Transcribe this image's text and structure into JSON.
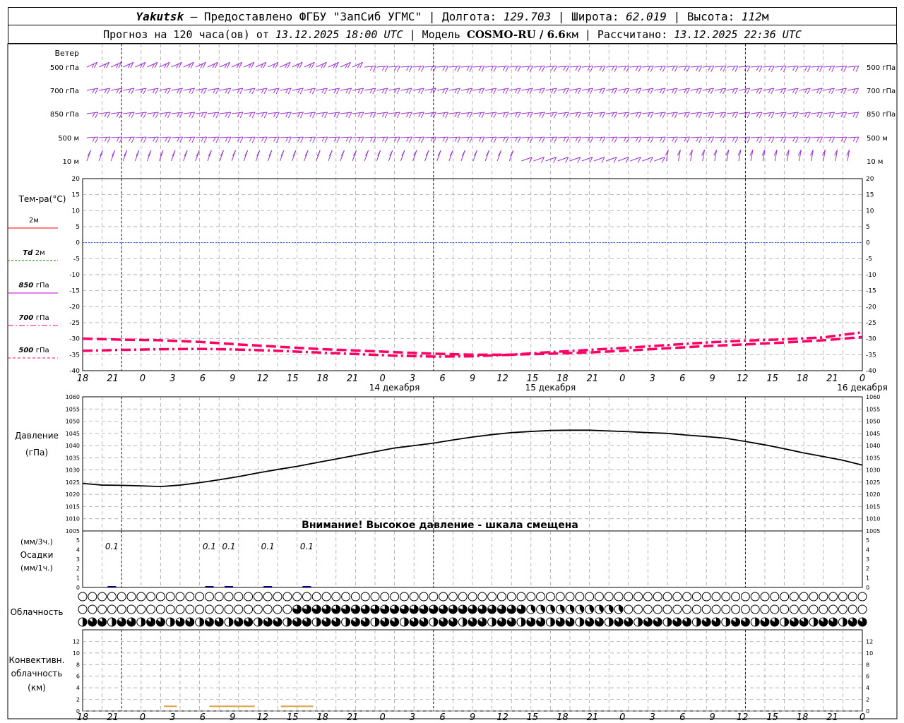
{
  "header": {
    "line1": {
      "station": "Yakutsk",
      "provider": " — Предоставлено ФГБУ \"ЗапСиб УГМС\" | Долгота: ",
      "lon": "129.703",
      "lat_label": " | Широта: ",
      "lat": "62.019",
      "alt_label": " | Высота: ",
      "alt": "112",
      "alt_unit": "м"
    },
    "line2": {
      "forecast_label": "Прогноз на 120 часа(ов) от ",
      "start": "13.12.2025 18:00 UTC",
      "model_label": " | Модель ",
      "model": "COSMO-RU / 6.6",
      "model_unit": "км",
      "calc_label": " | Рассчитано: ",
      "calc": "13.12.2025 22:36 UTC"
    }
  },
  "colors": {
    "wind": "#9933cc",
    "t2m": "#ff0000",
    "td2m": "#008000",
    "t850": "#cc00cc",
    "t700": "#ff0066",
    "t500": "#ff0066",
    "zero_line": "#3355ff",
    "pressure": "#000000",
    "precip": "#000080",
    "convective": "#d9a040",
    "grid": "#999999"
  },
  "chart_data": {
    "type": "line",
    "time_axis": {
      "start": "2025-12-13 18:00 UTC",
      "end": "2025-12-17 00:00 UTC",
      "tick_labels": [
        "18",
        "21",
        "0",
        "3",
        "6",
        "9",
        "12",
        "15",
        "18",
        "21",
        "0",
        "3",
        "6",
        "9",
        "12",
        "15",
        "18",
        "21",
        "0",
        "3",
        "6",
        "9",
        "12",
        "15",
        "18",
        "21",
        "0"
      ],
      "day_labels": [
        "14 декабря",
        "15 декабря",
        "16 декабря"
      ]
    },
    "wind": {
      "title": "Ветер",
      "levels": [
        "500 гПа",
        "700 гПа",
        "850 гПа",
        "500 м",
        "10  м"
      ]
    },
    "temperature": {
      "title": "Тем-ра(°C)",
      "legend": [
        {
          "label": "2м",
          "italic_prefix": ""
        },
        {
          "label": "2м",
          "italic_prefix": "Td"
        },
        {
          "label": "гПа",
          "italic_prefix": "850"
        },
        {
          "label": "гПа",
          "italic_prefix": "700"
        },
        {
          "label": "гПа",
          "italic_prefix": "500"
        }
      ],
      "ylim": [
        -40,
        20
      ],
      "tick_labels": [
        "20",
        "15",
        "10",
        "5",
        "0",
        "-5",
        "-10",
        "-15",
        "-20",
        "-25",
        "-30",
        "-35",
        "-40"
      ],
      "series": [
        {
          "name": "700 гПа",
          "hours": [
            0,
            6,
            12,
            18,
            24,
            30,
            36,
            42,
            48,
            54,
            60,
            66,
            72,
            78,
            84,
            90,
            96,
            102,
            108,
            114,
            120
          ],
          "values": [
            -30,
            -30.3,
            -30.5,
            -31,
            -31.8,
            -32.5,
            -33.2,
            -33.7,
            -34.2,
            -34.7,
            -35,
            -35,
            -34.7,
            -34.3,
            -33.7,
            -33,
            -32.3,
            -31.8,
            -31.2,
            -30.5,
            -29.5
          ]
        },
        {
          "name": "500 гПа",
          "hours": [
            0,
            6,
            12,
            18,
            24,
            30,
            36,
            42,
            48,
            54,
            60,
            66,
            72,
            78,
            84,
            90,
            96,
            102,
            108,
            114,
            120
          ],
          "values": [
            -33.8,
            -33.5,
            -33.3,
            -33.2,
            -33.4,
            -33.8,
            -34.3,
            -34.8,
            -35.3,
            -35.6,
            -35.5,
            -35,
            -34.2,
            -33.5,
            -32.8,
            -32,
            -31.2,
            -30.6,
            -30.2,
            -29.6,
            -28
          ]
        }
      ]
    },
    "pressure": {
      "title": "Давление",
      "unit": "(гПа)",
      "ylim": [
        1005,
        1060
      ],
      "tick_labels": [
        "1060",
        "1055",
        "1050",
        "1045",
        "1040",
        "1035",
        "1030",
        "1025",
        "1020",
        "1015",
        "1010",
        "1005"
      ],
      "warning": "Внимание! Высокое давление - шкала смещена",
      "hours": [
        0,
        3,
        6,
        9,
        12,
        15,
        18,
        21,
        24,
        27,
        30,
        33,
        36,
        39,
        42,
        45,
        48,
        51,
        54,
        57,
        60,
        63,
        66,
        69,
        72,
        75,
        78,
        81,
        84,
        87,
        90,
        93,
        96,
        99,
        102,
        105,
        108,
        111,
        114,
        117,
        120
      ],
      "values": [
        1024.5,
        1023.8,
        1023.7,
        1023.5,
        1023.2,
        1023.8,
        1024.8,
        1026,
        1027.3,
        1028.8,
        1030.2,
        1031.5,
        1033,
        1034.5,
        1036,
        1037.5,
        1039,
        1040,
        1041,
        1042.3,
        1043.5,
        1044.5,
        1045.3,
        1045.8,
        1046.2,
        1046.3,
        1046.3,
        1046,
        1045.7,
        1045.3,
        1045,
        1044.3,
        1043.7,
        1043,
        1041.7,
        1040.3,
        1038.7,
        1037,
        1035.5,
        1034,
        1032
      ]
    },
    "precipitation": {
      "title": "Осадки",
      "unit_3h": "(мм/3ч.)",
      "unit_1h": "(мм/1ч.)",
      "ylim": [
        0,
        5
      ],
      "tick_labels": [
        "5",
        "4",
        "3",
        "2",
        "1",
        "0"
      ],
      "labels": [
        {
          "hour": 4.5,
          "text": "0.1"
        },
        {
          "hour": 19.5,
          "text": "0.1"
        },
        {
          "hour": 22.5,
          "text": "0.1"
        },
        {
          "hour": 28.5,
          "text": "0.1"
        },
        {
          "hour": 34.5,
          "text": "0.1"
        }
      ]
    },
    "cloudiness": {
      "title": "Облачность",
      "rows": 3
    },
    "convective": {
      "title": "Конвективн.",
      "title2": "облачность",
      "unit": "(км)",
      "ylim": [
        0,
        14
      ],
      "tick_labels": [
        "12",
        "10",
        "8",
        "6",
        "4",
        "2",
        "0"
      ],
      "segments": [
        {
          "from_hour": 12.5,
          "to_hour": 14.5,
          "value": 0.8
        },
        {
          "from_hour": 19.5,
          "to_hour": 26.5,
          "value": 0.8
        },
        {
          "from_hour": 30.5,
          "to_hour": 35.5,
          "value": 0.8
        }
      ]
    }
  }
}
